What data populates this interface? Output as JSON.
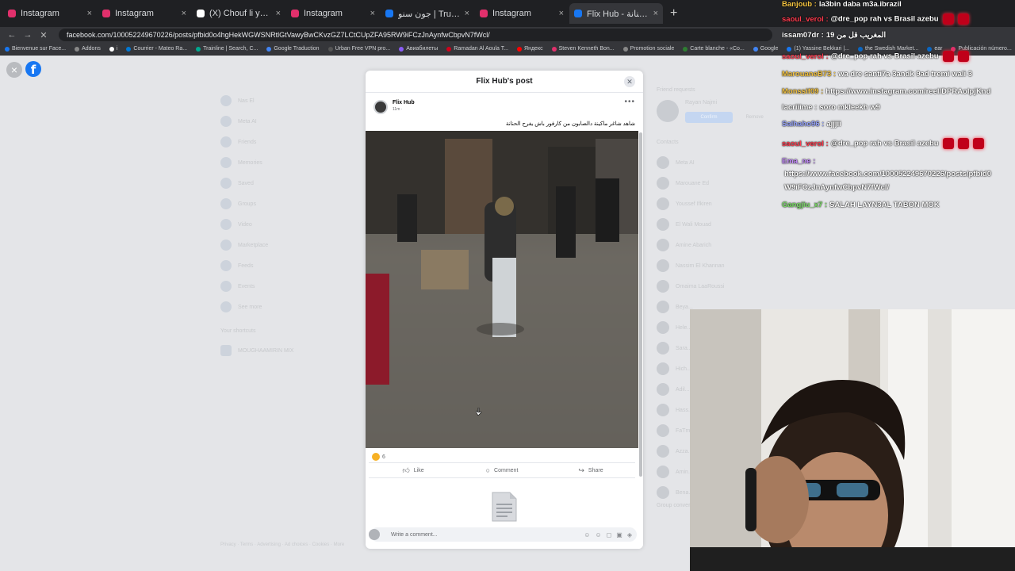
{
  "browser": {
    "tabs": [
      {
        "title": "Instagram",
        "color": "#e1306c",
        "active": false
      },
      {
        "title": "Instagram",
        "color": "#e1306c",
        "active": false
      },
      {
        "title": "(X) Chouf li y7wik on X: \"",
        "color": "#ffffff",
        "active": false
      },
      {
        "title": "Instagram",
        "color": "#e1306c",
        "active": false
      },
      {
        "title": "جون سنو | Truckers of Eur 3",
        "color": "#1877f2",
        "active": false
      },
      {
        "title": "Instagram",
        "color": "#e1306c",
        "active": false
      },
      {
        "title": "Flix Hub - كارفور باش يفرح الحنانة",
        "color": "#1877f2",
        "active": true
      }
    ],
    "url": "facebook.com/100052249670226/posts/pfbid0o4hgHekWGWSNRtlGtVawyBwCKvzGZ7LCtCUpZFA95RW9iFCzJnAynfwCbpvN7fWcl/",
    "bookmarks": [
      {
        "label": "Bienvenue sur Face...",
        "color": "#1877f2"
      },
      {
        "label": "Addons",
        "color": "#888888"
      },
      {
        "label": "i",
        "color": "#ffffff"
      },
      {
        "label": "Courrier - Mateo Ra...",
        "color": "#0078d4"
      },
      {
        "label": "Trainline | Search, C...",
        "color": "#00a88f"
      },
      {
        "label": "Google Traduction",
        "color": "#4285f4"
      },
      {
        "label": "Urban Free VPN pro...",
        "color": "#555555"
      },
      {
        "label": "Авиабилеты",
        "color": "#8a5cf6"
      },
      {
        "label": "Ramadan Al Aoula T...",
        "color": "#d0021b"
      },
      {
        "label": "Яндекс",
        "color": "#ff0000"
      },
      {
        "label": "Steven Kenneth Bon...",
        "color": "#e1306c"
      },
      {
        "label": "Promotion sociale",
        "color": "#888888"
      },
      {
        "label": "Carte blanche - «Co...",
        "color": "#2e7d32"
      },
      {
        "label": "Google",
        "color": "#4285f4"
      },
      {
        "label": "(1) Yassine Bekkari |...",
        "color": "#1877f2"
      },
      {
        "label": "the Swedish Market...",
        "color": "#0a66c2"
      },
      {
        "label": "ear",
        "color": "#0a66c2"
      },
      {
        "label": "Publicación número...",
        "color": "#e1306c"
      },
      {
        "label": "All Bookmarks",
        "color": "#888888"
      }
    ]
  },
  "sidenav": {
    "items": [
      "Nas El",
      "Meta AI",
      "Friends",
      "Memories",
      "Saved",
      "Groups",
      "Video",
      "Marketplace",
      "Feeds",
      "Events",
      "See more"
    ],
    "shortcuts_header": "Your shortcuts",
    "shortcuts": [
      "MOUGHAAMIRIN MIX"
    ],
    "footer": "Privacy · Terms · Advertising · Ad choices · Cookies · More"
  },
  "rightcol": {
    "requests_header": "Friend requests",
    "request_name": "Rayan Najmi",
    "confirm": "Confirm",
    "remove": "Remove",
    "contacts_header": "Contacts",
    "contacts": [
      "Meta AI",
      "Marouane Ed",
      "Youssef Ifkiren",
      "El Wali Mouad",
      "Amine Abarich",
      "Nassim El Khannan",
      "Omaima LaaRoussi",
      "Beya...",
      "Hele...",
      "Sara...",
      "Hich...",
      "Adil...",
      "Hass...",
      "FaTm...",
      "Azza...",
      "Amin...",
      "Bena..."
    ],
    "group_header": "Group conversations"
  },
  "post": {
    "modal_title": "Flix Hub's post",
    "author": "Flix Hub",
    "time": "11m ·",
    "text": "شاهد شاغر ماكينة دالصابون من كارفور باش يفرح الحنانة",
    "reaction_count": "6",
    "like": "Like",
    "comment": "Comment",
    "share": "Share",
    "comment_placeholder": "Write a comment..."
  },
  "chat": [
    {
      "user": "Banjoub :",
      "text": "la3bin daba m3a.ibrazil",
      "color": "#f5c542"
    },
    {
      "user": "saoul_verol :",
      "text": "@dre_pop rah vs Brasil azebu",
      "color": "#ff3b4e"
    },
    {
      "user": "issam07dr :",
      "text": "المغريب قل من 19",
      "color": "#ffffff"
    },
    {
      "user": "saoul_verol :",
      "text": "@dre_pop rah vs Brasil azebu",
      "color": "#ff3b4e"
    },
    {
      "user": "MarouaneB73 :",
      "text": "wa dre santi7a 3andk 9ad tremi wali 3",
      "color": "#f5c542"
    },
    {
      "user": "Monssif09 :",
      "text": "https://www.instagram.com/reel/DPRAolpjKnd",
      "color": "#f5c542"
    },
    {
      "user": "lacriiime :",
      "text": "soro mkleekh w9",
      "color": "#ffffff"
    },
    {
      "user": "Salhaho96 :",
      "text": "ajjjii",
      "color": "#9aa7ff"
    },
    {
      "user": "saoul_verol :",
      "text": "@dre_pop rah vs Brasil azebu",
      "color": "#ff3b4e"
    },
    {
      "user": "Ema_ne :",
      "text": "",
      "color": "#c58bff"
    },
    {
      "user": "",
      "text": "https://www.facebook.com/100052249670226/posts/pfbid0",
      "color": "#ffffff"
    },
    {
      "user": "",
      "text": "W9iFCzJnAynfwCbpvN7fWcl/",
      "color": "#ffffff"
    },
    {
      "user": "Gangjiu_x7 :",
      "text": "SALAH LAYN3AL TABON MOK",
      "color": "#7ee36a"
    }
  ],
  "icons": {
    "close": "close-icon",
    "facebook": "facebook-logo-icon",
    "more": "more-options-icon",
    "like": "thumbs-up-icon",
    "comment": "comment-bubble-icon",
    "share": "share-arrow-icon",
    "document": "document-icon"
  }
}
